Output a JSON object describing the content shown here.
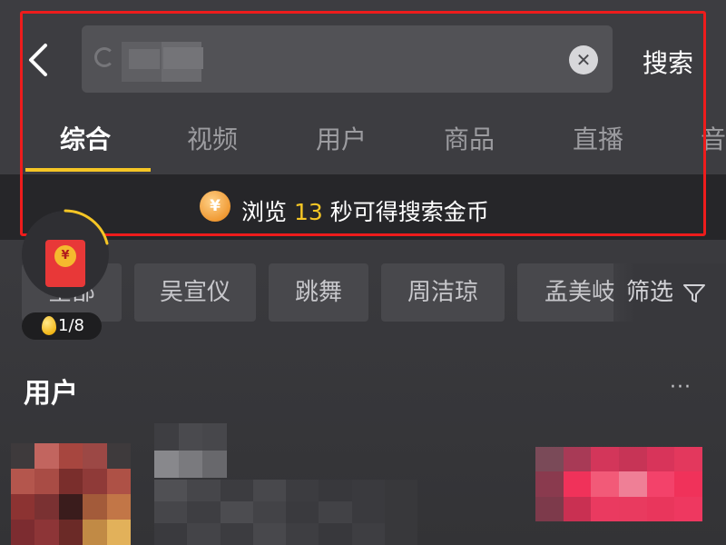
{
  "search": {
    "query": "",
    "submit_label": "搜索"
  },
  "tabs": [
    {
      "label": "综合",
      "active": true
    },
    {
      "label": "视频",
      "active": false
    },
    {
      "label": "用户",
      "active": false
    },
    {
      "label": "商品",
      "active": false
    },
    {
      "label": "直播",
      "active": false
    },
    {
      "label": "音",
      "active": false
    }
  ],
  "banner": {
    "prefix": "浏览 ",
    "seconds": "13",
    "suffix": " 秒可得搜索金币",
    "coin_symbol": "¥"
  },
  "filters": {
    "chips": [
      "全部",
      "吴宣仪",
      "跳舞",
      "周洁琼",
      "孟美岐"
    ],
    "filter_label": "筛选"
  },
  "reward": {
    "progress_text": "1/8",
    "packet_symbol": "¥"
  },
  "user_section": {
    "title": "用户",
    "more_label": "···"
  },
  "colors": {
    "accent_yellow": "#f5c625",
    "highlight_red": "#ee1c1c",
    "follow_button_pink": "#f0325a"
  },
  "icons": {
    "back": "chevron-left-icon",
    "clear": "close-circle-icon",
    "coin": "coin-icon",
    "filter": "funnel-icon",
    "red_packet": "red-packet-icon",
    "egg": "golden-egg-icon"
  }
}
